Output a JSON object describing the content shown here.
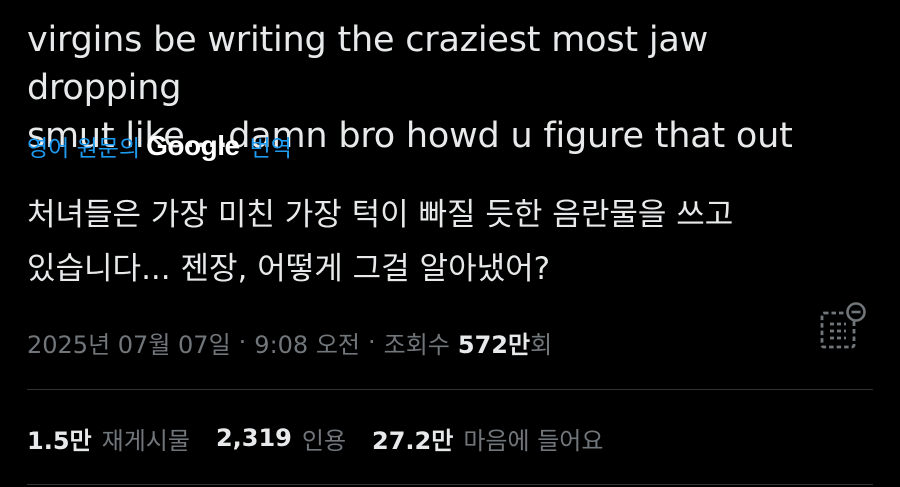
{
  "tweet": {
    "text_line1": "virgins be writing the craziest most jaw dropping",
    "text_line2": "smut like....damn bro howd u figure that out",
    "translate": {
      "prefix": "영어 원문의",
      "brand": "Google",
      "suffix": "번역"
    },
    "translated_line1": "처녀들은 가장 미친 가장 턱이 빠질 듯한 음란물을 쓰고",
    "translated_line2": "있습니다... 젠장, 어떻게 그걸 알아냈어?",
    "meta": {
      "date": "2025년 07월 07일",
      "separator1": "·",
      "time": "9:08 오전",
      "separator2": "·",
      "views_label": "조회수",
      "views_number": "572만",
      "views_suffix": "회"
    },
    "stats": {
      "reposts_num": "1.5만",
      "reposts_label": "재게시물",
      "quotes_num": "2,319",
      "quotes_label": "인용",
      "likes_num": "27.2만",
      "likes_label": "마음에 들어요"
    },
    "icons": {
      "analytics": "analytics-icon"
    },
    "colors": {
      "background": "#000000",
      "text_primary": "#e7e9ea",
      "text_secondary": "#71767b",
      "link": "#1d9bf0",
      "divider": "#2f3336"
    }
  }
}
